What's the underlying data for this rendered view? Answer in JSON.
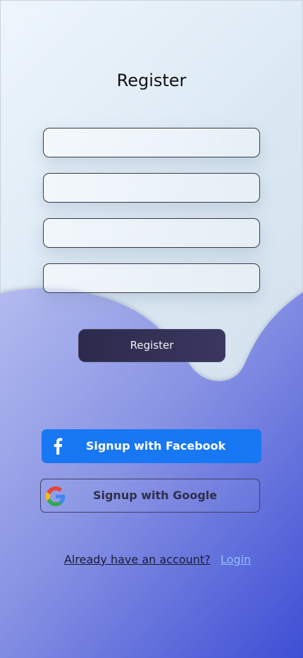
{
  "page": {
    "title": "Register"
  },
  "form": {
    "fields": [
      {
        "value": "",
        "placeholder": ""
      },
      {
        "value": "",
        "placeholder": ""
      },
      {
        "value": "",
        "placeholder": ""
      },
      {
        "value": "",
        "placeholder": ""
      }
    ],
    "submit_label": "Register"
  },
  "social": {
    "facebook_label": "Signup with Facebook",
    "google_label": "Signup with Google",
    "facebook_icon": "facebook-icon",
    "google_icon": "google-icon"
  },
  "footer": {
    "prompt": "Already have an account?",
    "login_label": "Login"
  },
  "colors": {
    "background_top": "#e4eef7",
    "wave_start": "#a9b3ec",
    "wave_end": "#3f52d6",
    "button_dark": "#2c2a4c",
    "facebook_blue": "#1877f2",
    "login_link": "#8fc0ff"
  }
}
